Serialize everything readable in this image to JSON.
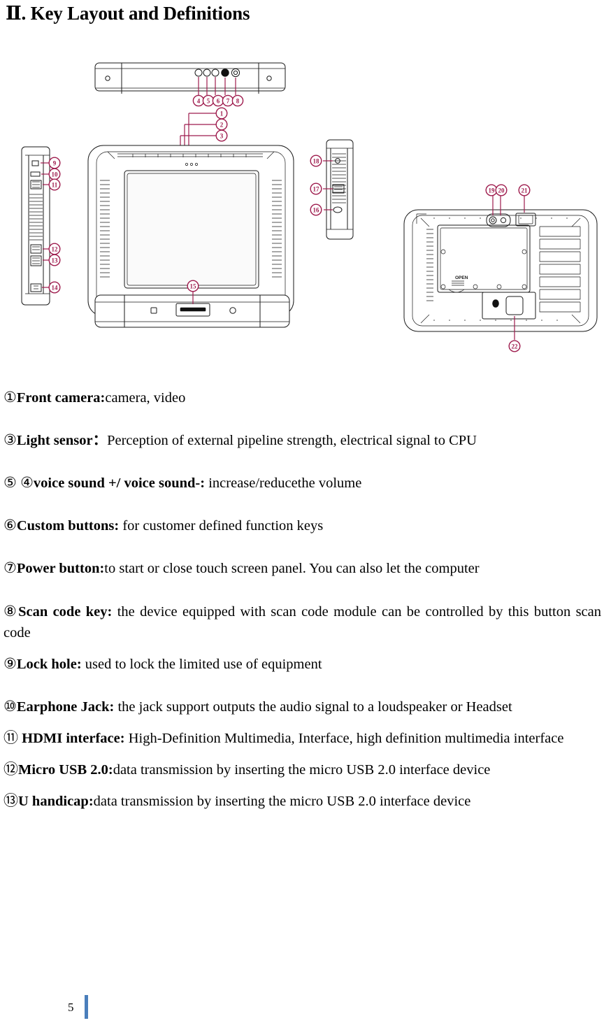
{
  "document": {
    "title": "Ⅱ. Key Layout and Definitions",
    "page_number": "5"
  },
  "figure": {
    "name": "rugged-tablet-key-layout-diagram",
    "callout_color": "#9e1b4d",
    "line_color": "#1a1a1a",
    "battery_cover_label": "OPEN",
    "views": [
      {
        "name": "top-edge-view",
        "callouts": [
          "4",
          "5",
          "6",
          "7",
          "8"
        ]
      },
      {
        "name": "front-view",
        "callouts": [
          "1",
          "2",
          "3"
        ]
      },
      {
        "name": "left-side-view",
        "callouts": [
          "9",
          "10",
          "11",
          "12",
          "13",
          "14"
        ]
      },
      {
        "name": "bottom-edge-view",
        "callouts": [
          "15"
        ]
      },
      {
        "name": "right-side-view",
        "callouts": [
          "16",
          "17",
          "18"
        ]
      },
      {
        "name": "back-view",
        "callouts": [
          "19",
          "20",
          "21",
          "22"
        ]
      }
    ],
    "callout_labels": {
      "c1": "1",
      "c2": "2",
      "c3": "3",
      "c4": "4",
      "c5": "5",
      "c6": "6",
      "c7": "7",
      "c8": "8",
      "c9": "9",
      "c10": "10",
      "c11": "11",
      "c12": "12",
      "c13": "13",
      "c14": "14",
      "c15": "15",
      "c16": "16",
      "c17": "17",
      "c18": "18",
      "c19": "19",
      "c20": "20",
      "c21": "21",
      "c22": "22"
    }
  },
  "definitions": [
    {
      "marker": "①",
      "term": "Front camera:",
      "desc": "camera, video"
    },
    {
      "marker": "③",
      "term": "Light sensor：",
      "desc": "Perception of external pipeline strength, electrical signal to CPU"
    },
    {
      "marker": "⑤ ④",
      "term": "voice sound +/ voice sound-:",
      "desc": " increase/reducethe volume"
    },
    {
      "marker": "⑥",
      "term": "Custom buttons:",
      "desc": " for customer defined function keys"
    },
    {
      "marker": "⑦",
      "term": "Power button:",
      "desc": "to start or close touch screen panel. You can also let the computer"
    },
    {
      "marker": "⑧",
      "term": "Scan code key:",
      "desc": " the device equipped with scan code module can be controlled by this button scan code"
    },
    {
      "marker": "⑨",
      "term": "Lock hole:",
      "desc": " used to lock the limited use of equipment"
    },
    {
      "marker": "⑩",
      "term": "Earphone Jack:",
      "desc": " the jack support outputs the audio signal to a loudspeaker or Headset"
    },
    {
      "marker": "⑪",
      "term": " HDMI interface:",
      "desc": " High-Definition Multimedia, Interface, high definition multimedia interface"
    },
    {
      "marker": "⑫",
      "term": "Micro USB 2.0:",
      "desc": "data transmission by inserting the micro USB 2.0 interface device"
    },
    {
      "marker": "⑬",
      "term": "U handicap:",
      "desc": "data transmission by inserting the micro USB 2.0 interface device"
    }
  ]
}
